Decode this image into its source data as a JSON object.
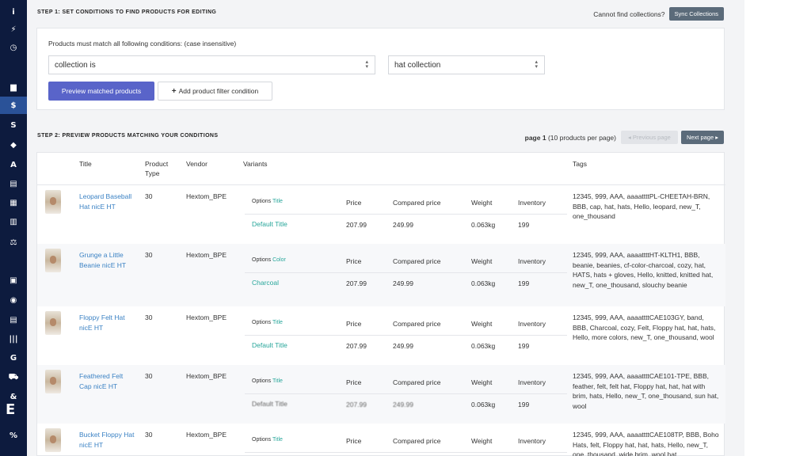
{
  "sidebar": {
    "icons": [
      "info-icon",
      "bolt-icon",
      "clock-icon",
      "truck-icon",
      "dollar-icon",
      "strikethrough-s-icon",
      "tag-icon",
      "font-a-icon",
      "document-icon",
      "grid-icon",
      "building-icon",
      "balance-scale-icon",
      "shield-icon",
      "eye-icon",
      "file-icon",
      "barcode-icon",
      "google-g-icon",
      "cart-icon",
      "cookie-icon",
      "percent-icon"
    ],
    "glyphs": [
      "i",
      "⚡",
      "◷",
      "▆",
      "$",
      "S",
      "◆",
      "A",
      "▤",
      "▦",
      "▥",
      "⚖",
      "▣",
      "◉",
      "▤",
      "|||",
      "G",
      "⛟",
      "&",
      "%"
    ],
    "active_index": 4
  },
  "step1": {
    "title": "STEP 1: SET CONDITIONS TO FIND PRODUCTS FOR EDITING",
    "cannot_find": "Cannot find collections?",
    "sync_label": "Sync Collections",
    "conditions_text": "Products must match all following conditions: (case insensitive)",
    "field_select": "collection is",
    "value_select": "hat collection",
    "preview_label": "Preview matched products",
    "add_condition_label": "Add product filter condition"
  },
  "step2": {
    "title": "STEP 2: PREVIEW PRODUCTS MATCHING YOUR CONDITIONS",
    "page_label": "page 1",
    "per_page": "(10 products per page)",
    "prev_label": "◂ Previous page",
    "next_label": "Next page ▸"
  },
  "table": {
    "headers": {
      "title": "Title",
      "product_type": "Product Type",
      "vendor": "Vendor",
      "variants": "Variants",
      "tags": "Tags"
    },
    "variant_headers": {
      "options": "Options",
      "price": "Price",
      "compared": "Compared price",
      "weight": "Weight",
      "inventory": "Inventory"
    },
    "rows": [
      {
        "title": "Leopard Baseball Hat nicE HT",
        "type": "30",
        "vendor": "Hextom_BPE",
        "option_name": "Title",
        "option_value": "Default Title",
        "price": "207.99",
        "compared": "249.99",
        "weight": "0.063kg",
        "inventory": "199",
        "tags": "12345, 999, AAA, aaaattttPL-CHEETAH-BRN, BBB, cap, hat, hats, Hello, leopard, new_T, one_thousand"
      },
      {
        "title": "Grunge a Little Beanie nicE HT",
        "type": "30",
        "vendor": "Hextom_BPE",
        "option_name": "Color",
        "option_value": "Charcoal",
        "price": "207.99",
        "compared": "249.99",
        "weight": "0.063kg",
        "inventory": "199",
        "tags": "12345, 999, AAA, aaaattttHT-KLTH1, BBB, beanie, beanies, cf-color-charcoal, cozy, hat, HATS, hats + gloves, Hello, knitted, knitted hat, new_T, one_thousand, slouchy beanie"
      },
      {
        "title": "Floppy Felt Hat nicE HT",
        "type": "30",
        "vendor": "Hextom_BPE",
        "option_name": "Title",
        "option_value": "Default Title",
        "price": "207.99",
        "compared": "249.99",
        "weight": "0.063kg",
        "inventory": "199",
        "tags": "12345, 999, AAA, aaaattttCAE103GY, band, BBB, Charcoal, cozy, Felt, Floppy hat, hat, hats, Hello, more colors, new_T, one_thousand, wool"
      },
      {
        "title": "Feathered Felt Cap nicE HT",
        "type": "30",
        "vendor": "Hextom_BPE",
        "option_name": "Title",
        "option_value": "Default Title",
        "price": "207.99",
        "compared": "249.99",
        "weight": "0.063kg",
        "inventory": "199",
        "tags": "12345, 999, AAA, aaaattttCAE101-TPE, BBB, feather, felt, felt hat, Floppy hat, hat, hat with brim, hats, Hello, new_T, one_thousand, sun hat, wool"
      },
      {
        "title": "Bucket Floppy Hat nicE HT",
        "type": "30",
        "vendor": "Hextom_BPE",
        "option_name": "Title",
        "option_value": "",
        "price": "",
        "compared": "",
        "weight": "",
        "inventory": "",
        "tags": "12345, 999, AAA, aaaattttCAE108TP, BBB, Boho Hats, felt, Floppy hat, hat, hats, Hello, new_T, one_thousand, wide brim, wool hat"
      }
    ]
  }
}
